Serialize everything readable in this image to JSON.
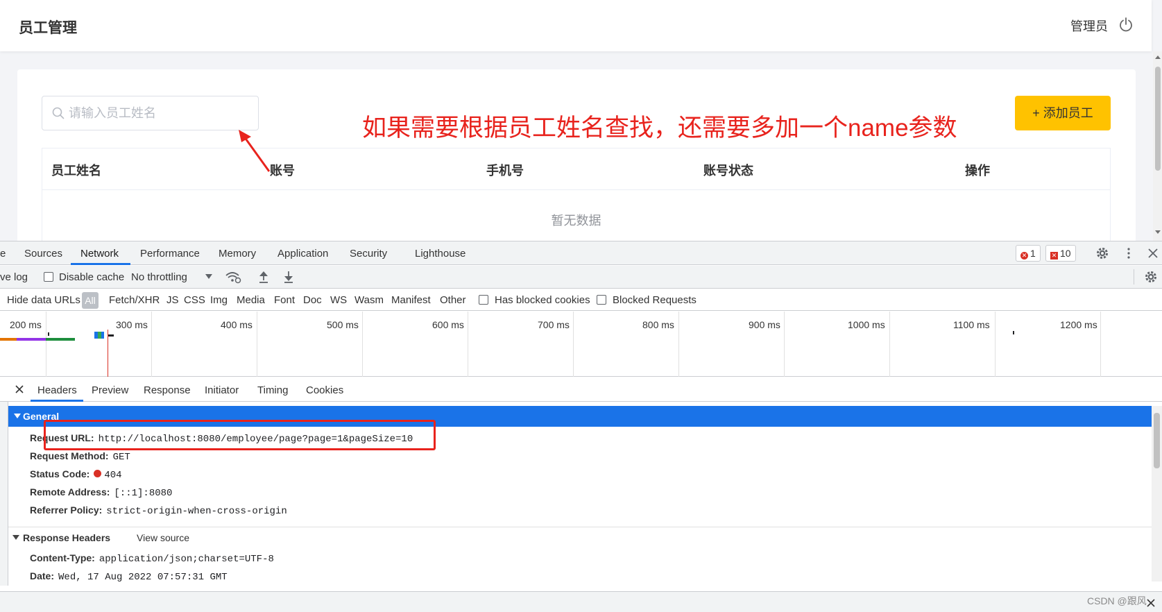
{
  "app": {
    "title": "员工管理",
    "admin_name": "管理员",
    "search": {
      "placeholder": "请输入员工姓名",
      "value": ""
    },
    "add_button": "+ 添加员工",
    "table": {
      "columns": [
        "员工姓名",
        "账号",
        "手机号",
        "账号状态",
        "操作"
      ],
      "empty_text": "暂无数据"
    },
    "annotation": "如果需要根据员工姓名查找，还需要多加一个name参数"
  },
  "devtools": {
    "tabs": [
      "e",
      "Sources",
      "Network",
      "Performance",
      "Memory",
      "Application",
      "Security",
      "Lighthouse"
    ],
    "active_tab": "Network",
    "error_count": "1",
    "issue_count": "10",
    "toolbar": {
      "preserve_log": "ve log",
      "disable_cache": "Disable cache",
      "throttling": "No throttling"
    },
    "filters": {
      "hide_data_urls": "Hide data URLs",
      "all": "All",
      "types": [
        "Fetch/XHR",
        "JS",
        "CSS",
        "Img",
        "Media",
        "Font",
        "Doc",
        "WS",
        "Wasm",
        "Manifest",
        "Other"
      ],
      "has_blocked_cookies": "Has blocked cookies",
      "blocked_requests": "Blocked Requests"
    },
    "timeline": {
      "ticks": [
        "200 ms",
        "300 ms",
        "400 ms",
        "500 ms",
        "600 ms",
        "700 ms",
        "800 ms",
        "900 ms",
        "1000 ms",
        "1100 ms",
        "1200 ms"
      ]
    },
    "detail_tabs": [
      "Headers",
      "Preview",
      "Response",
      "Initiator",
      "Timing",
      "Cookies"
    ],
    "active_detail_tab": "Headers",
    "general": {
      "title": "General",
      "request_url_label": "Request URL:",
      "request_url": "http://localhost:8080/employee/page?page=1&pageSize=10",
      "request_method_label": "Request Method:",
      "request_method": "GET",
      "status_code_label": "Status Code:",
      "status_code": "404",
      "remote_address_label": "Remote Address:",
      "remote_address": "[::1]:8080",
      "referrer_policy_label": "Referrer Policy:",
      "referrer_policy": "strict-origin-when-cross-origin"
    },
    "response_headers": {
      "title": "Response Headers",
      "view_source": "View source",
      "content_type_label": "Content-Type:",
      "content_type": "application/json;charset=UTF-8",
      "date_label": "Date:",
      "date": "Wed, 17 Aug 2022 07:57:31 GMT"
    },
    "watermark": "CSDN @跟风"
  }
}
